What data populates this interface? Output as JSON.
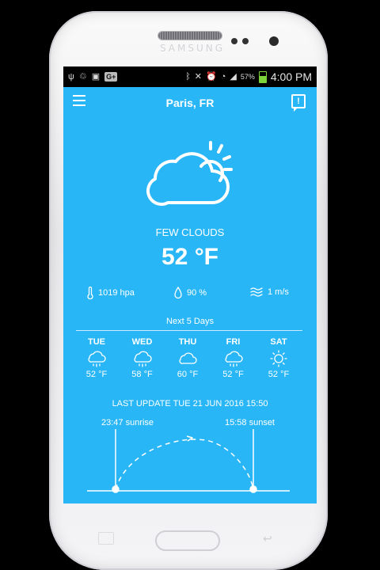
{
  "device": {
    "brand": "SAMSUNG"
  },
  "statusbar": {
    "left_icons": [
      "usb-icon",
      "recycle-icon",
      "image-icon",
      "google-plus-icon"
    ],
    "gplus_label": "G+",
    "right_icons": [
      "bluetooth-icon",
      "mute-icon",
      "alarm-icon",
      "wifi-icon",
      "signal-icon"
    ],
    "battery": "57%",
    "time": "4:00 PM"
  },
  "header": {
    "city": "Paris, FR"
  },
  "current": {
    "icon": "few-clouds-icon",
    "condition": "FEW CLOUDS",
    "temperature": "52 °F",
    "pressure": "1019 hpa",
    "humidity": "90 %",
    "wind": "1 m/s"
  },
  "forecast": {
    "title": "Next 5 Days",
    "days": [
      {
        "name": "TUE",
        "temp": "52 °F",
        "icon": "rain-cloud-icon"
      },
      {
        "name": "WED",
        "temp": "58 °F",
        "icon": "rain-cloud-icon"
      },
      {
        "name": "THU",
        "temp": "60 °F",
        "icon": "cloud-icon"
      },
      {
        "name": "FRI",
        "temp": "52 °F",
        "icon": "rain-cloud-icon"
      },
      {
        "name": "SAT",
        "temp": "52 °F",
        "icon": "sun-icon"
      }
    ]
  },
  "last_update": "LAST UPDATE TUE 21 JUN 2016 15:50",
  "sun": {
    "sunrise": "23:47 sunrise",
    "sunset": "15:58 sunset"
  },
  "colors": {
    "app_bg": "#29b6f6",
    "text": "#ffffff",
    "battery": "#7cd43a"
  }
}
